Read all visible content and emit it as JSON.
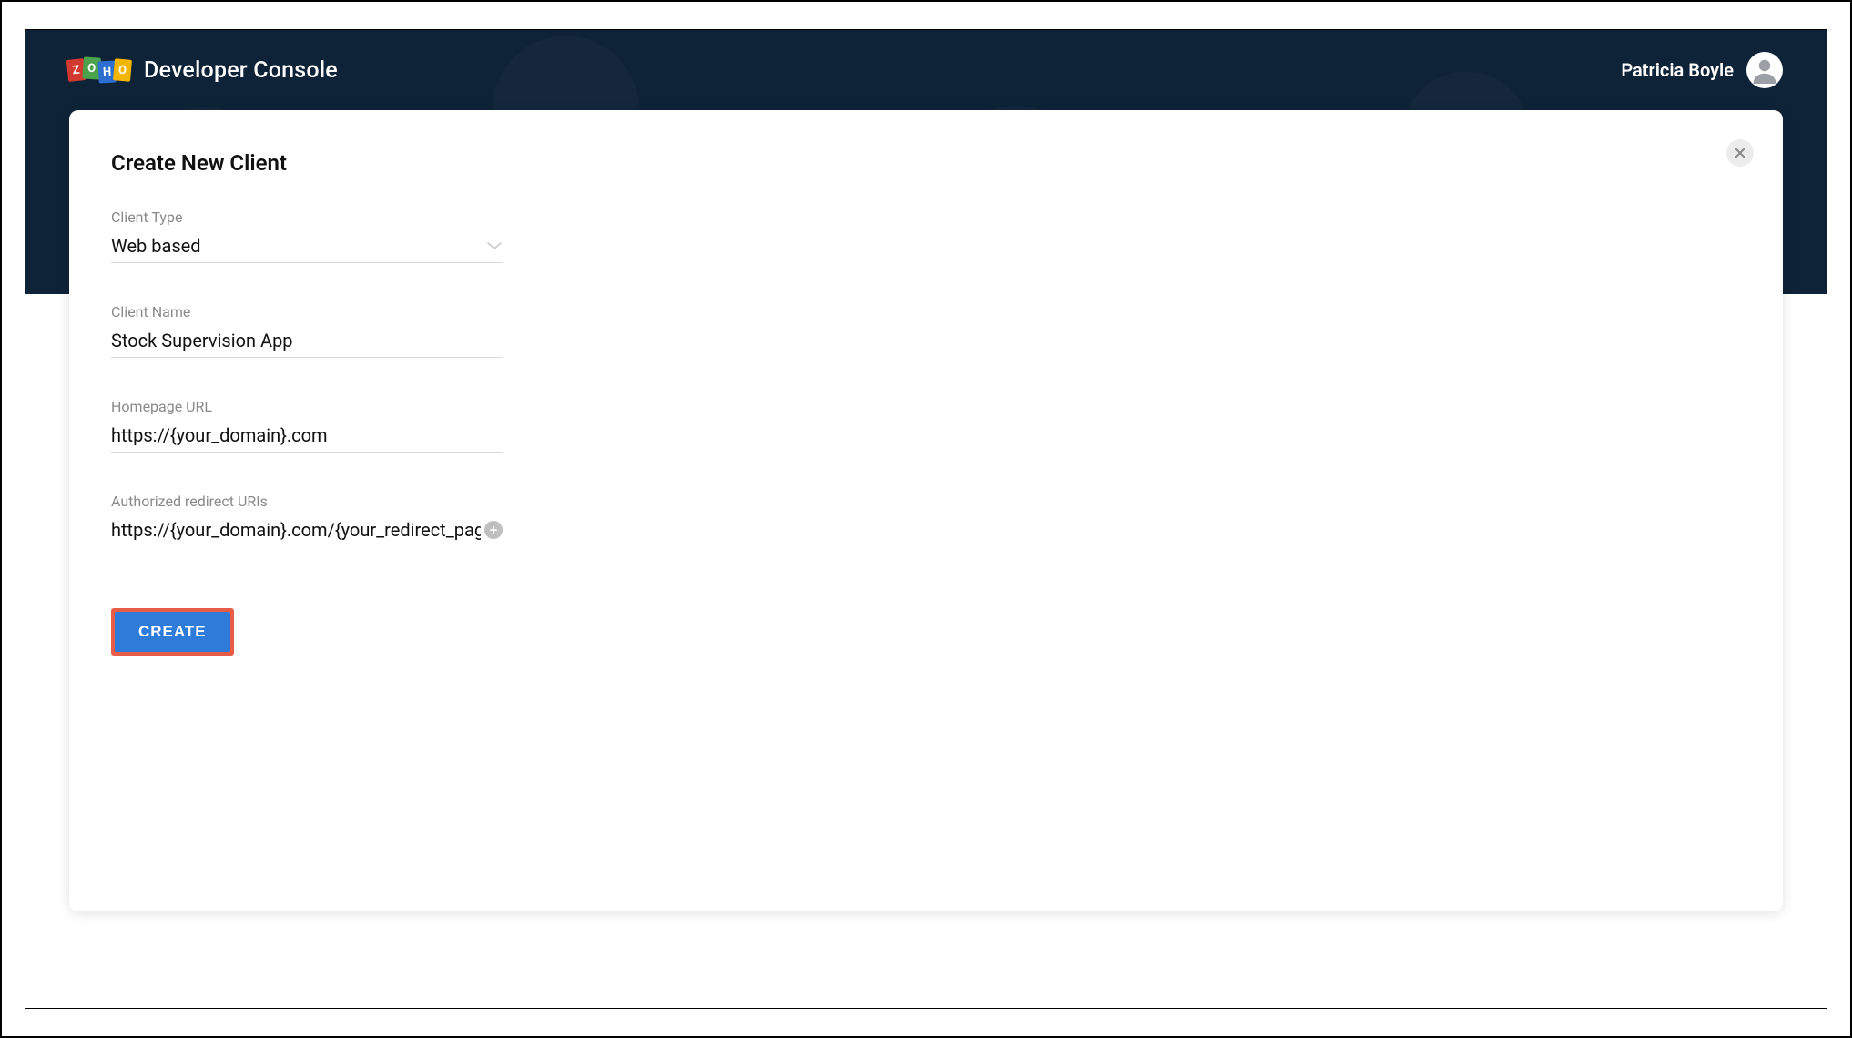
{
  "header": {
    "logo_letters": [
      "Z",
      "O",
      "H",
      "O"
    ],
    "app_title": "Developer Console",
    "user_name": "Patricia Boyle"
  },
  "card": {
    "title": "Create New Client"
  },
  "form": {
    "client_type": {
      "label": "Client Type",
      "value": "Web based"
    },
    "client_name": {
      "label": "Client Name",
      "value": "Stock Supervision App"
    },
    "homepage_url": {
      "label": "Homepage URL",
      "value": "https://{your_domain}.com"
    },
    "redirect_uris": {
      "label": "Authorized redirect URIs",
      "value": "https://{your_domain}.com/{your_redirect_page}"
    },
    "submit_label": "CREATE"
  }
}
